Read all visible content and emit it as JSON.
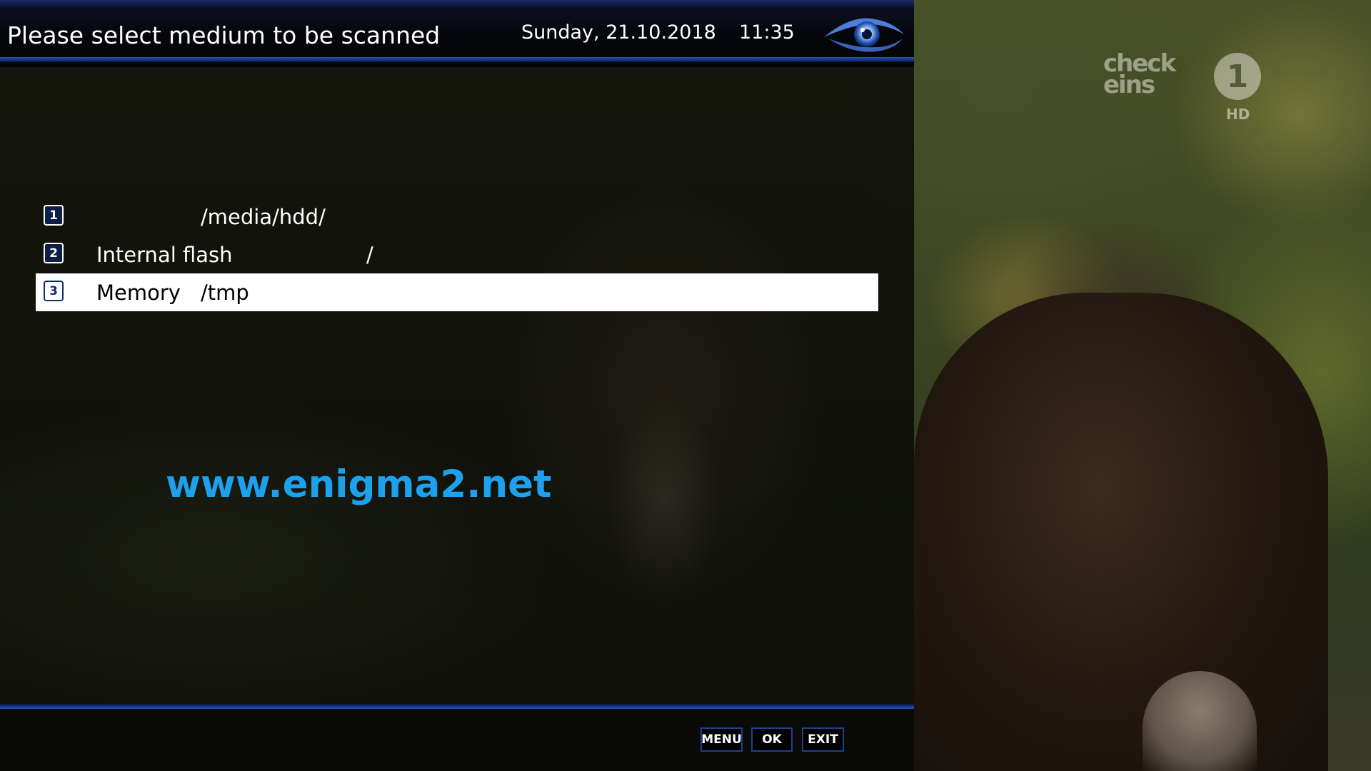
{
  "header": {
    "title": "Please select medium to be scanned",
    "date": "Sunday, 21.10.2018",
    "time": "11:35",
    "logo_icon": "eye-logo-icon"
  },
  "list": {
    "items": [
      {
        "number": "1",
        "name": "",
        "path": "/media/hdd/",
        "selected": false
      },
      {
        "number": "2",
        "name": "Internal flash",
        "path": "/",
        "selected": false
      },
      {
        "number": "3",
        "name": "Memory",
        "path": "/tmp",
        "selected": true
      }
    ]
  },
  "watermark": "www.enigma2.net",
  "channel_logo": {
    "wordmark": "check eins",
    "number": "1",
    "badge": "HD"
  },
  "footer": {
    "buttons": [
      "MENU",
      "OK",
      "EXIT"
    ]
  },
  "colors": {
    "accent_blue": "#163a8c",
    "watermark_blue": "#1da1ee",
    "selection": "#ffffff"
  }
}
